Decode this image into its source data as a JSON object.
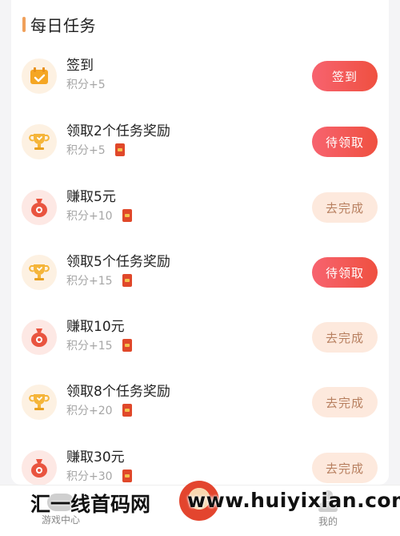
{
  "section": {
    "title": "每日任务",
    "accent_color": "#f0a05a"
  },
  "tasks": [
    {
      "name": "签到",
      "points": "积分+5",
      "icon": "calendar-check-icon",
      "reward_packet": false,
      "button": "签到",
      "button_style": "red"
    },
    {
      "name": "领取2个任务奖励",
      "points": "积分+5",
      "icon": "trophy-icon",
      "reward_packet": true,
      "button": "待领取",
      "button_style": "red"
    },
    {
      "name": "赚取5元",
      "points": "积分+10",
      "icon": "money-bag-icon",
      "reward_packet": true,
      "button": "去完成",
      "button_style": "peach"
    },
    {
      "name": "领取5个任务奖励",
      "points": "积分+15",
      "icon": "trophy-icon",
      "reward_packet": true,
      "button": "待领取",
      "button_style": "red"
    },
    {
      "name": "赚取10元",
      "points": "积分+15",
      "icon": "money-bag-icon",
      "reward_packet": true,
      "button": "去完成",
      "button_style": "peach"
    },
    {
      "name": "领取8个任务奖励",
      "points": "积分+20",
      "icon": "trophy-icon",
      "reward_packet": true,
      "button": "去完成",
      "button_style": "peach"
    },
    {
      "name": "赚取30元",
      "points": "积分+30",
      "icon": "money-bag-icon",
      "reward_packet": true,
      "button": "去完成",
      "button_style": "peach"
    }
  ],
  "tabbar": {
    "left_label": "游戏中心",
    "right_label": "我的"
  },
  "watermark": {
    "left": "汇一线首码网",
    "right": "www.huiyixian.com"
  },
  "colors": {
    "button_red": "#ef5040",
    "button_peach_bg": "#fde9dd",
    "button_peach_text": "#b88060",
    "icon_bg": "#fdf1e2",
    "money_bag_bg": "#fde8e4"
  }
}
